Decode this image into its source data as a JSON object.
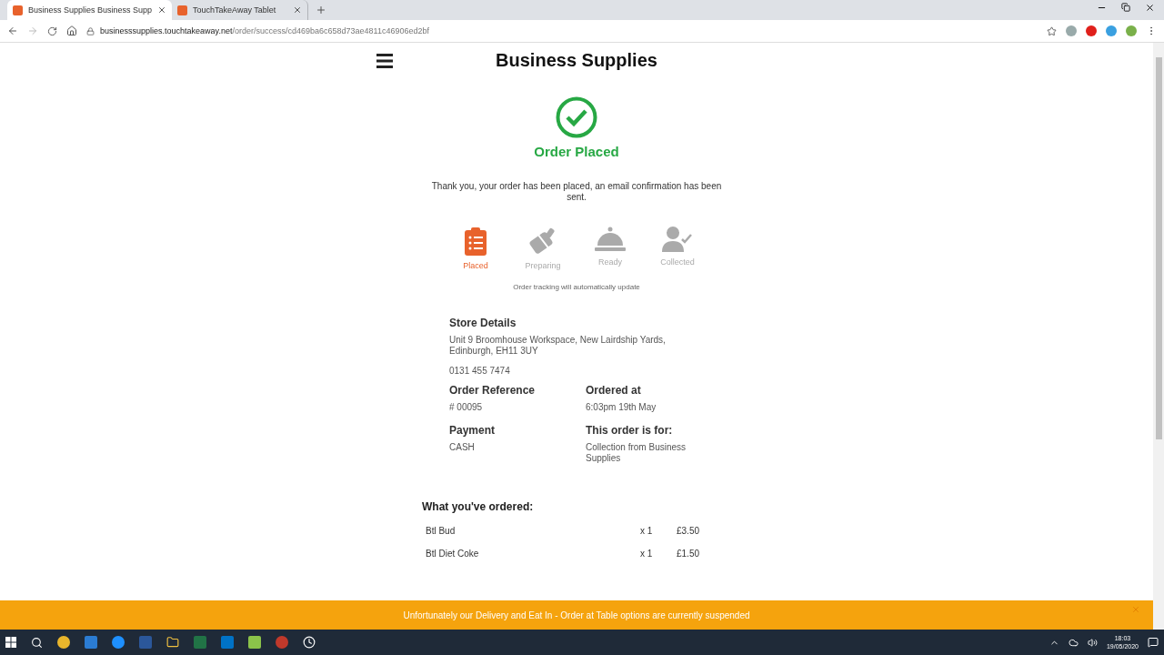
{
  "browser": {
    "tabs": [
      {
        "title": "Business Supplies Business Supp",
        "selected": true
      },
      {
        "title": "TouchTakeAway Tablet",
        "selected": false
      }
    ],
    "url_host": "businesssupplies.touchtakeaway.net",
    "url_path": "/order/success/cd469ba6c658d73ae4811c46906ed2bf"
  },
  "header": {
    "title": "Business Supplies"
  },
  "status": {
    "title": "Order Placed",
    "message": "Thank you, your order has been placed, an email confirmation has been sent."
  },
  "tracking": {
    "steps": [
      {
        "kind": "placed",
        "label": "Placed",
        "selected": true
      },
      {
        "kind": "preparing",
        "label": "Preparing",
        "selected": false
      },
      {
        "kind": "ready",
        "label": "Ready",
        "selected": false
      },
      {
        "kind": "collected",
        "label": "Collected",
        "selected": false
      }
    ],
    "note": "Order tracking will automatically update"
  },
  "store": {
    "heading": "Store Details",
    "address": "Unit 9 Broomhouse Workspace, New Lairdship Yards, Edinburgh, EH11 3UY",
    "phone": "0131 455 7474"
  },
  "details": [
    {
      "heading": "Order Reference",
      "value": "# 00095"
    },
    {
      "heading": "Ordered at",
      "value": "6:03pm 19th May"
    },
    {
      "heading": "Payment",
      "value": "CASH"
    },
    {
      "heading": "This order is for:",
      "value": "Collection from Business Supplies"
    }
  ],
  "order": {
    "heading": "What you've ordered:",
    "items": [
      {
        "name": "Btl Bud",
        "qty": "x 1",
        "price": "£3.50"
      },
      {
        "name": "Btl Diet Coke",
        "qty": "x 1",
        "price": "£1.50"
      }
    ]
  },
  "banner": {
    "text": "Unfortunately our Delivery and Eat In - Order at Table options are currently suspended"
  },
  "taskbar": {
    "time": "18:03",
    "date": "19/05/2020"
  }
}
